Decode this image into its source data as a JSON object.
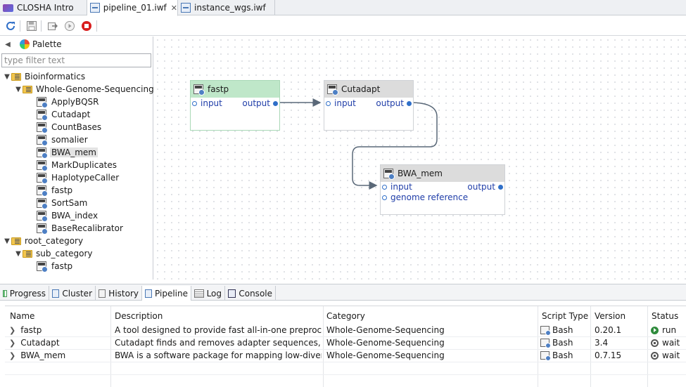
{
  "editor_tabs": [
    {
      "label": "CLOSHA Intro",
      "icon": "closha-logo-icon",
      "active": false
    },
    {
      "label": "pipeline_01.iwf",
      "icon": "workflow-file-icon",
      "active": true,
      "close": "✕"
    },
    {
      "label": "instance_wgs.iwf",
      "icon": "workflow-file-icon",
      "active": false
    }
  ],
  "toolbar": {
    "icons": [
      "refresh-icon",
      "save-icon",
      "export-icon",
      "run-icon",
      "stop-icon"
    ],
    "colors": {
      "refresh": "#2f6fc8",
      "stop": "#d81e1e"
    }
  },
  "palette": {
    "title": "Palette",
    "filter_placeholder": "type filter text",
    "tree": [
      {
        "label": "Bioinformatics",
        "type": "category",
        "expanded": true
      },
      {
        "label": "Whole-Genome-Sequencing",
        "type": "category",
        "expanded": true
      },
      {
        "label": "ApplyBQSR",
        "type": "tool"
      },
      {
        "label": "Cutadapt",
        "type": "tool"
      },
      {
        "label": "CountBases",
        "type": "tool"
      },
      {
        "label": "somalier",
        "type": "tool"
      },
      {
        "label": "BWA_mem",
        "type": "tool",
        "selected": true
      },
      {
        "label": "MarkDuplicates",
        "type": "tool"
      },
      {
        "label": "HaplotypeCaller",
        "type": "tool"
      },
      {
        "label": "fastp",
        "type": "tool"
      },
      {
        "label": "SortSam",
        "type": "tool"
      },
      {
        "label": "BWA_index",
        "type": "tool"
      },
      {
        "label": "BaseRecalibrator",
        "type": "tool"
      },
      {
        "label": "root_category",
        "type": "category",
        "expanded": true
      },
      {
        "label": "sub_category",
        "type": "category",
        "expanded": true
      },
      {
        "label": "fastp",
        "type": "tool"
      }
    ]
  },
  "canvas": {
    "nodes": [
      {
        "title": "fastp",
        "status_color": "#bfe7c9",
        "inputs": [
          "input"
        ],
        "outputs": [
          "output"
        ]
      },
      {
        "title": "Cutadapt",
        "status_color": "#dcdcdc",
        "inputs": [
          "input"
        ],
        "outputs": [
          "output"
        ]
      },
      {
        "title": "BWA_mem",
        "status_color": "#dcdcdc",
        "inputs": [
          "input",
          "genome reference"
        ],
        "outputs": [
          "output"
        ]
      }
    ],
    "connections": [
      {
        "from": "fastp.output",
        "to": "Cutadapt.input"
      },
      {
        "from": "Cutadapt.output",
        "to": "BWA_mem.input"
      }
    ]
  },
  "view_tabs": [
    {
      "label": "Progress",
      "icon": "progress-icon",
      "active": false
    },
    {
      "label": "Cluster",
      "icon": "cluster-icon",
      "active": false
    },
    {
      "label": "History",
      "icon": "history-icon",
      "active": false
    },
    {
      "label": "Pipeline",
      "icon": "pipeline-icon",
      "active": true
    },
    {
      "label": "Log",
      "icon": "log-icon",
      "active": false
    },
    {
      "label": "Console",
      "icon": "console-icon",
      "active": false
    }
  ],
  "pipeline_table": {
    "columns": [
      "Name",
      "Description",
      "Category",
      "Script Type",
      "Version",
      "Status"
    ],
    "rows": [
      {
        "name": "fastp",
        "description": "A tool designed to provide fast all-in-one preproces...",
        "category": "Whole-Genome-Sequencing",
        "script_type": "Bash",
        "version": "0.20.1",
        "status": "run"
      },
      {
        "name": "Cutadapt",
        "description": "Cutadapt finds and removes adapter sequences, pri...",
        "category": "Whole-Genome-Sequencing",
        "script_type": "Bash",
        "version": "3.4",
        "status": "wait"
      },
      {
        "name": "BWA_mem",
        "description": "BWA is a software package for mapping low-diverge...",
        "category": "Whole-Genome-Sequencing",
        "script_type": "Bash",
        "version": "0.7.15",
        "status": "wait"
      }
    ]
  }
}
